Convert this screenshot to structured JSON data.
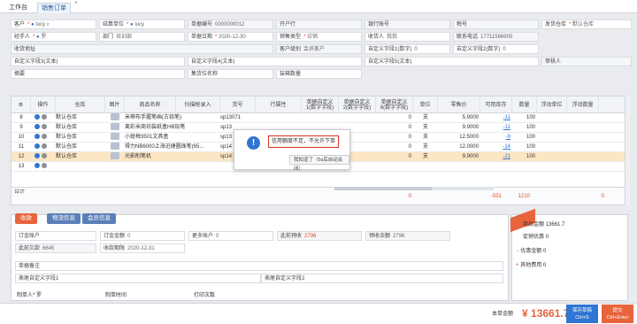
{
  "tabs": [
    {
      "label": "工作台"
    },
    {
      "label": "销售订单"
    }
  ],
  "tab_close": "×",
  "form": {
    "customer": {
      "label": "客户",
      "value": "lucy",
      "extra": "OX"
    },
    "settlement": {
      "label": "结算单位",
      "value": "lucy",
      "extra": "OX"
    },
    "order_no": {
      "label": "单据编号",
      "value": "0000000012"
    },
    "bank": {
      "label": "开户行",
      "value": ""
    },
    "bank_account": {
      "label": "银行账号",
      "value": ""
    },
    "tax_no": {
      "label": "税号",
      "value": ""
    },
    "warehouse": {
      "label": "发货仓库",
      "value": "默认仓库"
    },
    "handler": {
      "label": "经手人",
      "value": "罗"
    },
    "dept": {
      "label": "部门",
      "value": "培训部"
    },
    "date": {
      "label": "单据日期",
      "value": "2020-12-30"
    },
    "sales_type": {
      "label": "销售类型",
      "value": "访销"
    },
    "receiver": {
      "label": "收货人",
      "value": "我我"
    },
    "phone": {
      "label": "联系电话",
      "value": "17711566905"
    },
    "address": {
      "label": "收货地址",
      "value": ""
    },
    "customer_level": {
      "label": "客户级别",
      "value": "会员客户"
    },
    "custom1": {
      "label": "自定义字段1(数字)",
      "value": "0"
    },
    "custom2": {
      "label": "自定义字段2(数字)",
      "value": "0"
    },
    "custom3": {
      "label": "自定义字段3(文本)",
      "value": ""
    },
    "custom4": {
      "label": "自定义字段4(文本)",
      "value": ""
    },
    "custom5": {
      "label": "自定义字段5(文本)",
      "value": ""
    },
    "reviewer": {
      "label": "审核人",
      "value": ""
    },
    "summary": {
      "label": "摘要",
      "value": ""
    },
    "assembly": {
      "label": "集货位名称",
      "value": ""
    },
    "packing": {
      "label": "装箱数量",
      "value": ""
    }
  },
  "grid": {
    "headers": [
      "操作",
      "仓库",
      "图片",
      "商品名称",
      "扫描枪录入",
      "货号",
      "行属性",
      "单据自定义1(数字字段)",
      "单据自定义2(数字字段)",
      "单据自定义6(数字字段)",
      "单位",
      "零售价",
      "可用库存",
      "数量",
      "浮动单位",
      "浮动数量"
    ],
    "rows": [
      {
        "no": "8",
        "warehouse": "默认仓库",
        "name": "米蒂布手握笔画(古铅笔)",
        "sku": "sp13071",
        "qty_val": "0",
        "unit": "支",
        "price": "5.9000",
        "stock": "-11",
        "qty": "100"
      },
      {
        "no": "9",
        "warehouse": "默认仓库",
        "name": "离彩米商坊装纸盒HB铅笔",
        "sku": "sp13",
        "qty_val": "0",
        "unit": "支",
        "price": "9.9000",
        "stock": "-11",
        "qty": "100"
      },
      {
        "no": "10",
        "warehouse": "默认仓库",
        "name": "小斑梅3501文具盒",
        "sku": "sp13",
        "qty_val": "0",
        "unit": "支",
        "price": "12.5000",
        "stock": "-9",
        "qty": "100"
      },
      {
        "no": "11",
        "warehouse": "默认仓库",
        "name": "得力NB6000上海迅捷圆珠笔(65...",
        "sku": "sp14",
        "qty_val": "0",
        "unit": "支",
        "price": "12.0000",
        "stock": "-14",
        "qty": "100"
      },
      {
        "no": "12",
        "warehouse": "默认仓库",
        "name": "光影削笔机",
        "sku": "sp14",
        "qty_val": "0",
        "unit": "支",
        "price": "9.9000",
        "stock": "-21",
        "qty": "100"
      },
      {
        "no": "13",
        "warehouse": "",
        "name": "",
        "sku": "",
        "qty_val": "",
        "unit": "",
        "price": "",
        "stock": "",
        "qty": ""
      }
    ],
    "total_label": "合计",
    "total_qty_val": "0",
    "total_stock": "-551",
    "total_qty": "1210",
    "total_zero": "0"
  },
  "modal": {
    "icon": "!",
    "message": "信用额度不足，不允许下单",
    "ok": "我知道了（5s后自动关闭）"
  },
  "bottom_tabs": [
    "收款",
    "物流信息",
    "会员信息"
  ],
  "lower": {
    "deposit_account": {
      "label": "订金账户",
      "value": ""
    },
    "deposit_amount": {
      "label": "订金金额",
      "value": "0"
    },
    "more_accounts": {
      "label": "更多账户",
      "value": "0"
    },
    "receivable": {
      "label": "此前预收",
      "value": "2796"
    },
    "prepaid_balance": {
      "label": "预收余额",
      "value": "2796"
    },
    "prev_due": {
      "label": "此前欠款",
      "value": "6645"
    },
    "pay_deadline": {
      "label": "收款期限",
      "value": "2020-12-31"
    },
    "remark": {
      "label": "单据备注",
      "value": ""
    },
    "tail1": {
      "label": "表尾自定义字段1",
      "value": ""
    },
    "tail2": {
      "label": "表尾自定义字段2",
      "value": ""
    },
    "creator": {
      "label": "制单人",
      "value": "罗"
    },
    "create_time": {
      "label": "制单时间",
      "value": ""
    },
    "print_count": {
      "label": "打印次数",
      "value": ""
    }
  },
  "right": {
    "ribbon": "",
    "goods_amount": {
      "label": "商品金额",
      "value": "13661.7"
    },
    "promo": {
      "label": "促销优惠",
      "value": "0"
    },
    "discount": {
      "label": "优惠金额",
      "value": "0"
    },
    "other": {
      "label": "其他费用",
      "value": "0"
    }
  },
  "footer": {
    "total_label": "本单金额",
    "currency": "¥",
    "total": "13661.7",
    "save_label": "保存草稿",
    "save_shortcut": "Ctrl+S",
    "submit_label": "提交",
    "submit_shortcut": "Ctrl+Enter"
  }
}
